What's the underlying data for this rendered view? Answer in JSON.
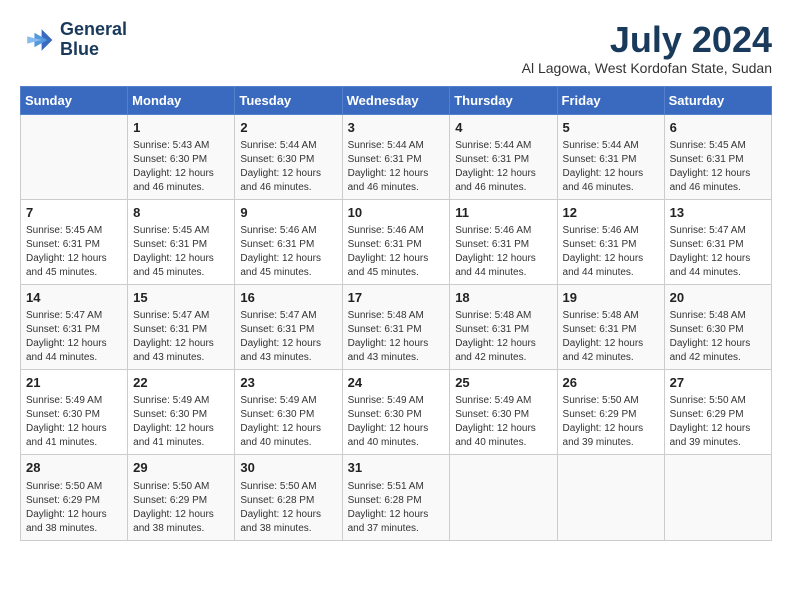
{
  "header": {
    "logo_line1": "General",
    "logo_line2": "Blue",
    "month_title": "July 2024",
    "subtitle": "Al Lagowa, West Kordofan State, Sudan"
  },
  "days_of_week": [
    "Sunday",
    "Monday",
    "Tuesday",
    "Wednesday",
    "Thursday",
    "Friday",
    "Saturday"
  ],
  "weeks": [
    [
      {
        "day": "",
        "sunrise": "",
        "sunset": "",
        "daylight": ""
      },
      {
        "day": "1",
        "sunrise": "5:43 AM",
        "sunset": "6:30 PM",
        "daylight": "12 hours and 46 minutes."
      },
      {
        "day": "2",
        "sunrise": "5:44 AM",
        "sunset": "6:30 PM",
        "daylight": "12 hours and 46 minutes."
      },
      {
        "day": "3",
        "sunrise": "5:44 AM",
        "sunset": "6:31 PM",
        "daylight": "12 hours and 46 minutes."
      },
      {
        "day": "4",
        "sunrise": "5:44 AM",
        "sunset": "6:31 PM",
        "daylight": "12 hours and 46 minutes."
      },
      {
        "day": "5",
        "sunrise": "5:44 AM",
        "sunset": "6:31 PM",
        "daylight": "12 hours and 46 minutes."
      },
      {
        "day": "6",
        "sunrise": "5:45 AM",
        "sunset": "6:31 PM",
        "daylight": "12 hours and 46 minutes."
      }
    ],
    [
      {
        "day": "7",
        "sunrise": "5:45 AM",
        "sunset": "6:31 PM",
        "daylight": "12 hours and 45 minutes."
      },
      {
        "day": "8",
        "sunrise": "5:45 AM",
        "sunset": "6:31 PM",
        "daylight": "12 hours and 45 minutes."
      },
      {
        "day": "9",
        "sunrise": "5:46 AM",
        "sunset": "6:31 PM",
        "daylight": "12 hours and 45 minutes."
      },
      {
        "day": "10",
        "sunrise": "5:46 AM",
        "sunset": "6:31 PM",
        "daylight": "12 hours and 45 minutes."
      },
      {
        "day": "11",
        "sunrise": "5:46 AM",
        "sunset": "6:31 PM",
        "daylight": "12 hours and 44 minutes."
      },
      {
        "day": "12",
        "sunrise": "5:46 AM",
        "sunset": "6:31 PM",
        "daylight": "12 hours and 44 minutes."
      },
      {
        "day": "13",
        "sunrise": "5:47 AM",
        "sunset": "6:31 PM",
        "daylight": "12 hours and 44 minutes."
      }
    ],
    [
      {
        "day": "14",
        "sunrise": "5:47 AM",
        "sunset": "6:31 PM",
        "daylight": "12 hours and 44 minutes."
      },
      {
        "day": "15",
        "sunrise": "5:47 AM",
        "sunset": "6:31 PM",
        "daylight": "12 hours and 43 minutes."
      },
      {
        "day": "16",
        "sunrise": "5:47 AM",
        "sunset": "6:31 PM",
        "daylight": "12 hours and 43 minutes."
      },
      {
        "day": "17",
        "sunrise": "5:48 AM",
        "sunset": "6:31 PM",
        "daylight": "12 hours and 43 minutes."
      },
      {
        "day": "18",
        "sunrise": "5:48 AM",
        "sunset": "6:31 PM",
        "daylight": "12 hours and 42 minutes."
      },
      {
        "day": "19",
        "sunrise": "5:48 AM",
        "sunset": "6:31 PM",
        "daylight": "12 hours and 42 minutes."
      },
      {
        "day": "20",
        "sunrise": "5:48 AM",
        "sunset": "6:30 PM",
        "daylight": "12 hours and 42 minutes."
      }
    ],
    [
      {
        "day": "21",
        "sunrise": "5:49 AM",
        "sunset": "6:30 PM",
        "daylight": "12 hours and 41 minutes."
      },
      {
        "day": "22",
        "sunrise": "5:49 AM",
        "sunset": "6:30 PM",
        "daylight": "12 hours and 41 minutes."
      },
      {
        "day": "23",
        "sunrise": "5:49 AM",
        "sunset": "6:30 PM",
        "daylight": "12 hours and 40 minutes."
      },
      {
        "day": "24",
        "sunrise": "5:49 AM",
        "sunset": "6:30 PM",
        "daylight": "12 hours and 40 minutes."
      },
      {
        "day": "25",
        "sunrise": "5:49 AM",
        "sunset": "6:30 PM",
        "daylight": "12 hours and 40 minutes."
      },
      {
        "day": "26",
        "sunrise": "5:50 AM",
        "sunset": "6:29 PM",
        "daylight": "12 hours and 39 minutes."
      },
      {
        "day": "27",
        "sunrise": "5:50 AM",
        "sunset": "6:29 PM",
        "daylight": "12 hours and 39 minutes."
      }
    ],
    [
      {
        "day": "28",
        "sunrise": "5:50 AM",
        "sunset": "6:29 PM",
        "daylight": "12 hours and 38 minutes."
      },
      {
        "day": "29",
        "sunrise": "5:50 AM",
        "sunset": "6:29 PM",
        "daylight": "12 hours and 38 minutes."
      },
      {
        "day": "30",
        "sunrise": "5:50 AM",
        "sunset": "6:28 PM",
        "daylight": "12 hours and 38 minutes."
      },
      {
        "day": "31",
        "sunrise": "5:51 AM",
        "sunset": "6:28 PM",
        "daylight": "12 hours and 37 minutes."
      },
      {
        "day": "",
        "sunrise": "",
        "sunset": "",
        "daylight": ""
      },
      {
        "day": "",
        "sunrise": "",
        "sunset": "",
        "daylight": ""
      },
      {
        "day": "",
        "sunrise": "",
        "sunset": "",
        "daylight": ""
      }
    ]
  ]
}
